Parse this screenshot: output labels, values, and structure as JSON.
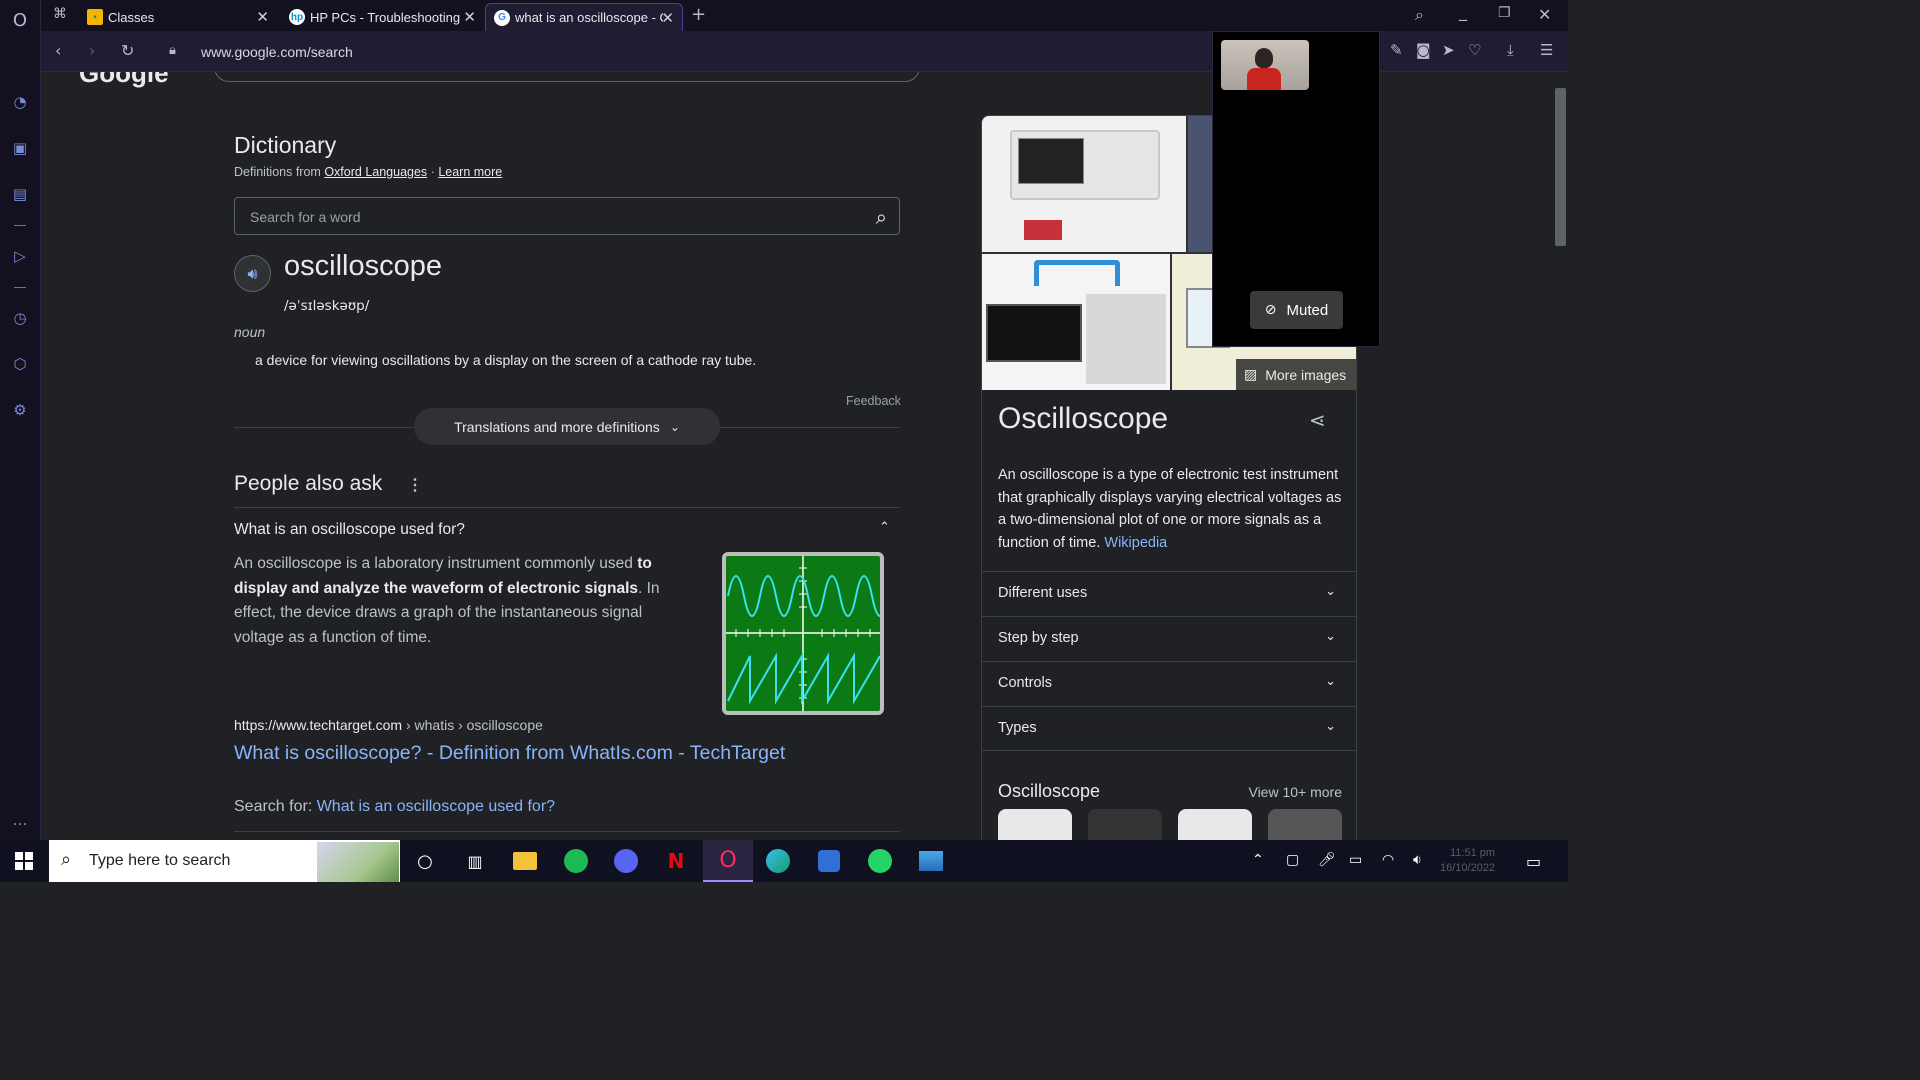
{
  "browser": {
    "tabs": [
      {
        "title": "Classes",
        "favicon": "classroom-icon"
      },
      {
        "title": "HP PCs - Troubleshooting V",
        "favicon": "hp-icon"
      },
      {
        "title": "what is an oscilloscope - Go",
        "favicon": "google-icon"
      }
    ],
    "url": "www.google.com/search"
  },
  "google": {
    "logo": "Google"
  },
  "dictionary": {
    "title": "Dictionary",
    "from_prefix": "Definitions from",
    "source": "Oxford Languages",
    "separator": "·",
    "learn_more": "Learn more",
    "search_placeholder": "Search for a word",
    "word": "oscilloscope",
    "phonetic": "/əˈsɪləskəʊp/",
    "part_of_speech": "noun",
    "definition": "a device for viewing oscillations by a display on the screen of a cathode ray tube.",
    "feedback": "Feedback",
    "translations_button": "Translations and more definitions"
  },
  "people_also_ask": {
    "title": "People also ask",
    "question": "What is an oscilloscope used for?",
    "answer_pre": "An oscilloscope is a laboratory instrument commonly used ",
    "answer_bold": "to display and analyze the waveform of electronic signals",
    "answer_post": ". In effect, the device draws a graph of the instantaneous signal voltage as a function of time.",
    "source_url": "https://www.techtarget.com",
    "source_path": " › whatis › oscilloscope",
    "result_title": "What is oscilloscope? - Definition from WhatIs.com - TechTarget",
    "search_for_label": "Search for: ",
    "search_for_link": "What is an oscilloscope used for?"
  },
  "knowledge_panel": {
    "more_images": "More images",
    "title": "Oscilloscope",
    "description": "An oscilloscope is a type of electronic test instrument that graphically displays varying electrical voltages as a two-dimensional plot of one or more signals as a function of time.",
    "wiki_link": "Wikipedia",
    "rows": [
      "Different uses",
      "Step by step",
      "Controls",
      "Types"
    ],
    "section_title": "Oscilloscope",
    "view_more": "View 10+ more"
  },
  "video_call": {
    "muted_label": "Muted"
  },
  "taskbar": {
    "search_placeholder": "Type here to search",
    "clock_time": "11:51 pm",
    "clock_date": "16/10/2022"
  },
  "colors": {
    "link": "#8ab4f8",
    "page_bg": "#202124",
    "opera_dark": "#13101f",
    "scope_green": "#0b7a14",
    "scope_trace": "#39e0f0"
  }
}
